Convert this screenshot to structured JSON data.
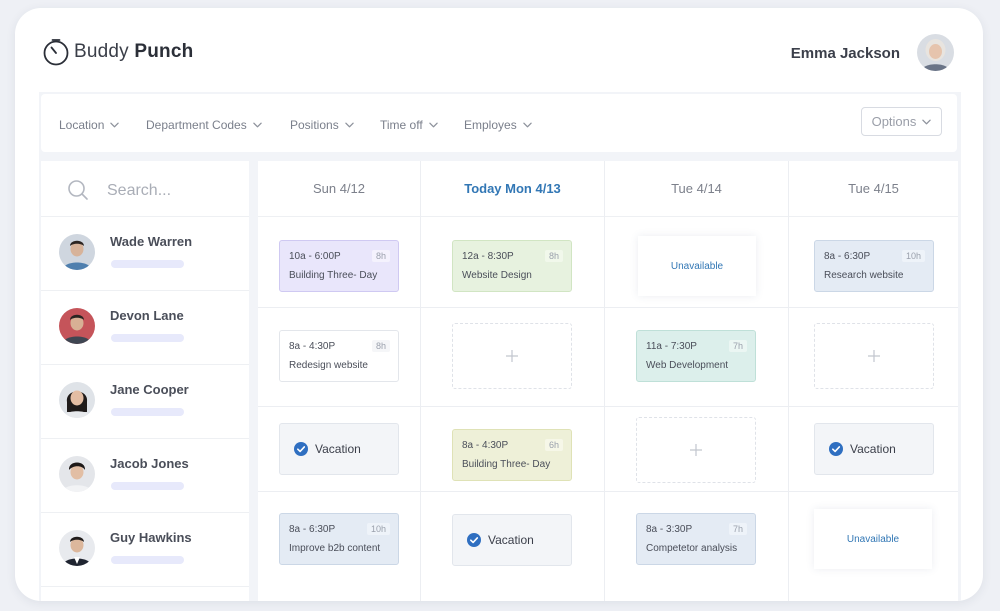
{
  "brand": {
    "name_light": "Buddy",
    "name_bold": "Punch"
  },
  "user": {
    "name": "Emma Jackson"
  },
  "filters": [
    {
      "label": "Location"
    },
    {
      "label": "Department Codes"
    },
    {
      "label": "Positions"
    },
    {
      "label": "Time off"
    },
    {
      "label": "Employes"
    }
  ],
  "options_label": "Options",
  "search": {
    "placeholder": "Search..."
  },
  "employees": [
    {
      "name": "Wade Warren"
    },
    {
      "name": "Devon Lane"
    },
    {
      "name": "Jane Cooper"
    },
    {
      "name": "Jacob Jones"
    },
    {
      "name": "Guy Hawkins"
    }
  ],
  "days": [
    {
      "label": "Sun 4/12"
    },
    {
      "label": "Today Mon 4/13"
    },
    {
      "label": "Tue 4/14"
    },
    {
      "label": "Tue 4/15"
    }
  ],
  "shifts": [
    {
      "time": "10a - 6:00P",
      "hours": "8h",
      "title": "Building Three- Day"
    },
    {
      "time": "12a - 8:30P",
      "hours": "8h",
      "title": "Website Design"
    },
    {
      "text": "Unavailable"
    },
    {
      "time": "8a - 6:30P",
      "hours": "10h",
      "title": "Research website"
    },
    {
      "time": "8a - 4:30P",
      "hours": "8h",
      "title": "Redesign website"
    },
    {
      "time": "11a - 7:30P",
      "hours": "7h",
      "title": "Web Development"
    },
    {
      "text": "Vacation"
    },
    {
      "time": "8a - 4:30P",
      "hours": "6h",
      "title": "Building Three- Day"
    },
    {
      "text": "Vacation"
    },
    {
      "time": "8a - 6:30P",
      "hours": "10h",
      "title": "Improve b2b content"
    },
    {
      "text": "Vacation"
    },
    {
      "time": "8a - 3:30P",
      "hours": "7h",
      "title": "Competetor analysis"
    },
    {
      "text": "Unavailable"
    }
  ],
  "colors": {
    "accent": "#3277b5",
    "purple": "#e9e6fb",
    "green": "#e7f2df",
    "blue": "#e4ebf4",
    "teal": "#dcefeb",
    "yellow": "#eef0d8"
  }
}
